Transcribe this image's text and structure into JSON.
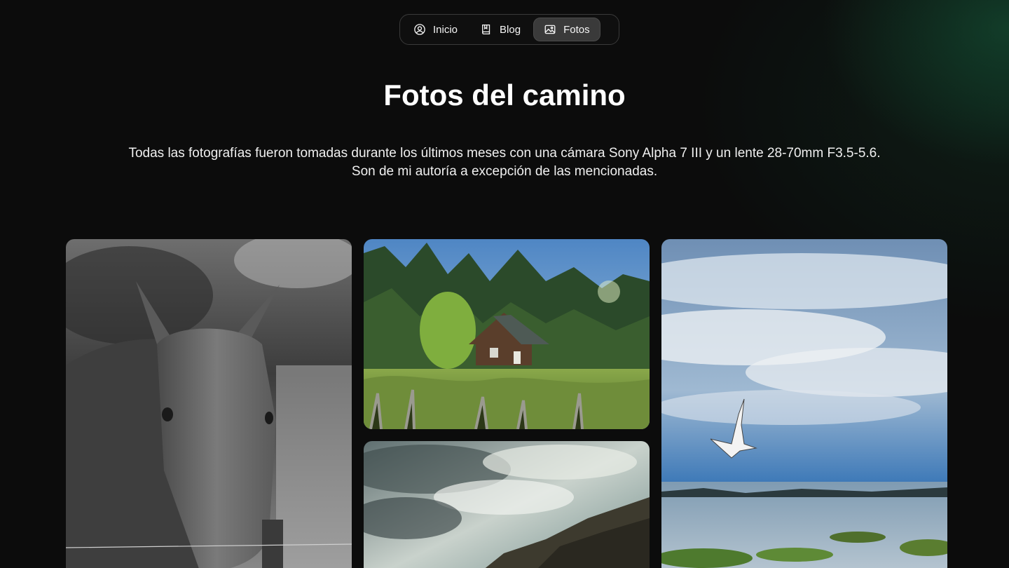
{
  "nav": {
    "items": [
      {
        "label": "Inicio",
        "icon": "user-circle-icon",
        "active": false
      },
      {
        "label": "Blog",
        "icon": "book-icon",
        "active": false
      },
      {
        "label": "Fotos",
        "icon": "image-icon",
        "active": true
      }
    ]
  },
  "page": {
    "title": "Fotos del camino",
    "description_line1": "Todas las fotografías fueron tomadas durante los últimos meses con una cámara Sony Alpha 7 III y un lente 28-70mm F3.5-5.6.",
    "description_line2": "Son de mi autoría a excepción de las mencionadas."
  },
  "gallery": {
    "photos": [
      {
        "subject": "horse",
        "style": "black-and-white"
      },
      {
        "subject": "house-in-forest",
        "style": "color"
      },
      {
        "subject": "cliff-and-clouds",
        "style": "color"
      },
      {
        "subject": "seagull-over-sea",
        "style": "color"
      }
    ]
  },
  "colors": {
    "background": "#0c0c0c",
    "accent_glow": "#165c3c",
    "nav_active": "#3a3a3a"
  }
}
